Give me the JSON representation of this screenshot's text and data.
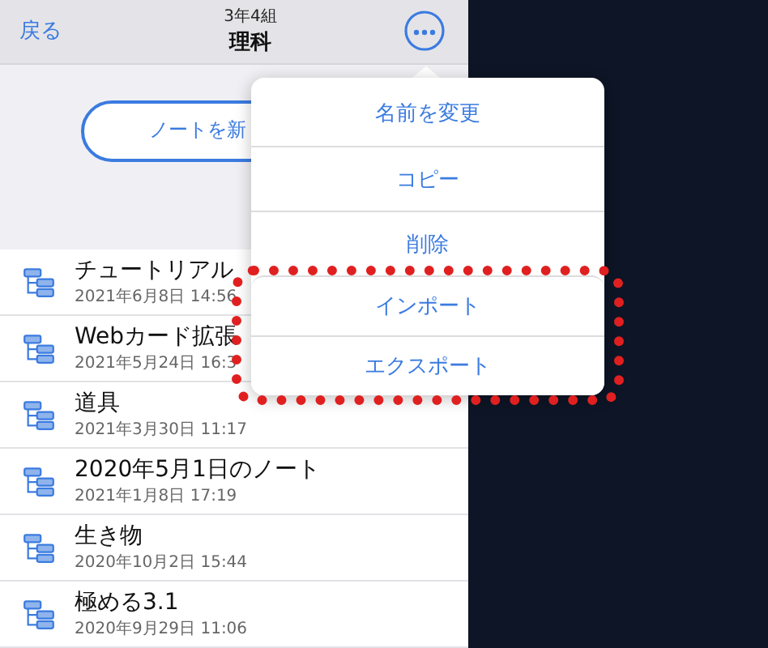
{
  "header": {
    "back": "戻る",
    "subtitle": "3年4組",
    "title": "理科"
  },
  "new_note_button": "ノートを新",
  "notes": [
    {
      "title": "チュートリアル",
      "date": "2021年6月8日 14:56"
    },
    {
      "title": "Webカード拡張",
      "date": "2021年5月24日 16:3"
    },
    {
      "title": "道具",
      "date": "2021年3月30日 11:17"
    },
    {
      "title": "2020年5月1日のノート",
      "date": "2021年1月8日 17:19"
    },
    {
      "title": "生き物",
      "date": "2020年10月2日 15:44"
    },
    {
      "title": "極める3.1",
      "date": "2020年9月29日 11:06"
    }
  ],
  "menu": {
    "items": [
      {
        "label": "名前を変更",
        "highlighted": false
      },
      {
        "label": "コピー",
        "highlighted": false
      },
      {
        "label": "削除",
        "highlighted": false
      },
      {
        "label": "インポート",
        "highlighted": true
      },
      {
        "label": "エクスポート",
        "highlighted": true
      }
    ]
  }
}
